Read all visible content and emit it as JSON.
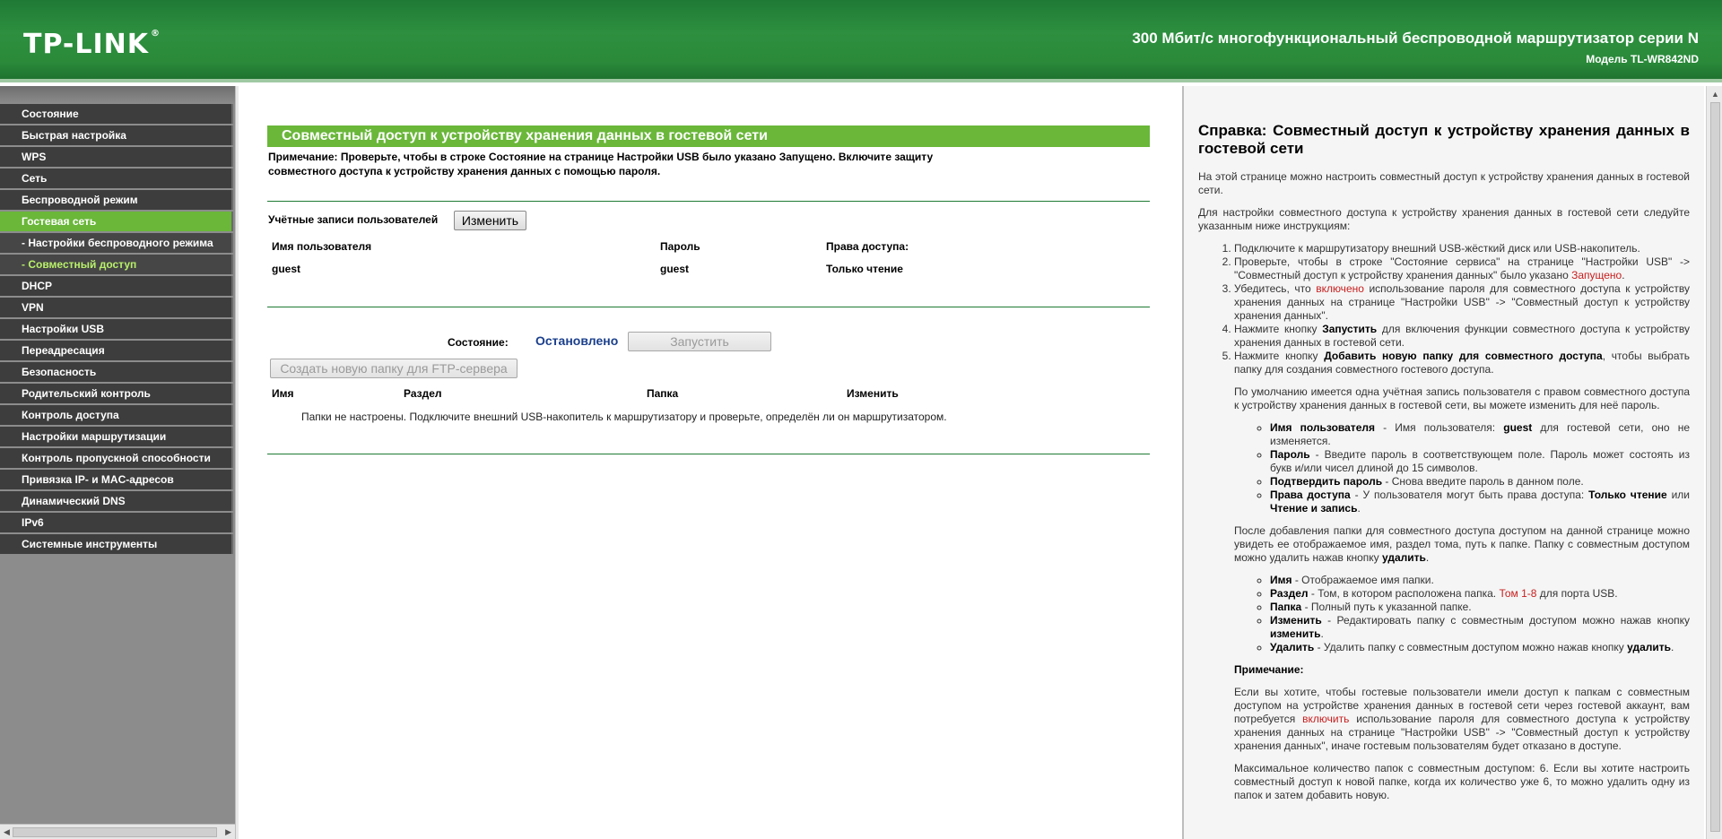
{
  "header": {
    "logo": "TP-LINK",
    "logo_mark": "®",
    "product_title": "300 Мбит/с многофункциональный беспроводной маршрутизатор серии N",
    "model": "Модель TL-WR842ND"
  },
  "sidebar": {
    "items": [
      {
        "label": "Состояние",
        "state": "normal"
      },
      {
        "label": "Быстрая настройка",
        "state": "normal"
      },
      {
        "label": "WPS",
        "state": "normal"
      },
      {
        "label": "Сеть",
        "state": "normal"
      },
      {
        "label": "Беспроводной режим",
        "state": "normal"
      },
      {
        "label": "Гостевая сеть",
        "state": "active"
      },
      {
        "label": "- Настройки беспроводного режима",
        "state": "sub"
      },
      {
        "label": "- Совместный доступ",
        "state": "sub-active"
      },
      {
        "label": "DHCP",
        "state": "normal"
      },
      {
        "label": "VPN",
        "state": "normal"
      },
      {
        "label": "Настройки USB",
        "state": "normal"
      },
      {
        "label": "Переадресация",
        "state": "normal"
      },
      {
        "label": "Безопасность",
        "state": "normal"
      },
      {
        "label": "Родительский контроль",
        "state": "normal"
      },
      {
        "label": "Контроль доступа",
        "state": "normal"
      },
      {
        "label": "Настройки маршрутизации",
        "state": "normal"
      },
      {
        "label": "Контроль пропускной способности",
        "state": "normal"
      },
      {
        "label": "Привязка IP- и MAC-адресов",
        "state": "normal"
      },
      {
        "label": "Динамический DNS",
        "state": "normal"
      },
      {
        "label": "IPv6",
        "state": "normal"
      },
      {
        "label": "Системные инструменты",
        "state": "normal"
      }
    ]
  },
  "main": {
    "title": "Совместный доступ к устройству хранения данных в гостевой сети",
    "note": "Примечание:    Проверьте, чтобы в строке Состояние на странице Настройки USB было указано Запущено. Включите защиту совместного доступа к устройству хранения данных с помощью пароля.",
    "accounts": {
      "label": "Учётные записи пользователей",
      "edit_button": "Изменить",
      "col_user": "Имя пользователя",
      "col_password": "Пароль",
      "col_rights": "Права доступа:",
      "user": "guest",
      "password": "guest",
      "rights": "Только чтение"
    },
    "status": {
      "label": "Состояние:",
      "value": "Остановлено",
      "start_button": "Запустить"
    },
    "new_folder_button": "Создать новую папку для FTP-сервера",
    "folders": {
      "col_name": "Имя",
      "col_volume": "Раздел",
      "col_folder": "Папка",
      "col_edit": "Изменить",
      "empty_message": "Папки не настроены. Подключите внешний USB-накопитель к маршрутизатору и проверьте, определён ли он маршрутизатором."
    }
  },
  "help": {
    "title": "Справка: Совместный доступ к устройству хранения данных в гостевой сети",
    "intro": "На этой странице можно настроить совместный доступ к устройству хранения данных в гостевой сети.",
    "instructions_intro": "Для настройки совместного доступа к устройству хранения данных в гостевой сети следуйте указанным ниже инструкциям:",
    "step1": "Подключите к маршрутизатору внешний USB-жёсткий диск или USB-накопитель.",
    "step2_a": "Проверьте, чтобы в строке \"Состояние сервиса\" на странице \"Настройки USB\" -> \"Совместный доступ к устройству хранения данных\" было указано ",
    "step2_red": "Запущено",
    "step2_b": ".",
    "step3_a": "Убедитесь, что ",
    "step3_red": "включено",
    "step3_b": " использование пароля для совместного доступа к устройству хранения данных на странице \"Настройки USB\" -> \"Совместный доступ к устройству хранения данных\".",
    "step4_a": "Нажмите кнопку ",
    "step4_bold": "Запустить",
    "step4_b": " для включения функции совместного доступа к устройству хранения данных в гостевой сети.",
    "step5_a": "Нажмите кнопку ",
    "step5_bold": "Добавить новую папку для совместного доступа",
    "step5_b": ", чтобы выбрать папку для создания совместного гостевого доступа.",
    "default_account": "По умолчанию имеется одна учётная запись пользователя с правом совместного доступа к устройству хранения данных в гостевой сети, вы можете изменить для неё пароль.",
    "acc_user_bold": "Имя пользователя",
    "acc_user_a": " - Имя пользователя: ",
    "acc_user_guest": "guest",
    "acc_user_b": " для гостевой сети, оно не изменяется.",
    "acc_pass_bold": "Пароль",
    "acc_pass_text": " - Введите пароль в соответствующем поле. Пароль может состоять из букв и/или чисел длиной до 15 символов.",
    "acc_confirm_bold": "Подтвердить пароль",
    "acc_confirm_text": " - Снова введите пароль в данном поле.",
    "acc_rights_bold": "Права доступа",
    "acc_rights_a": " - У пользователя могут быть права доступа: ",
    "acc_rights_ro": "Только чтение",
    "acc_rights_or": " или ",
    "acc_rights_rw": "Чтение и запись",
    "acc_rights_end": ".",
    "after_add_a": "После добавления папки для совместного доступа доступом на данной странице можно увидеть ее отображаемое имя, раздел тома, путь к папке. Папку с совместным доступом можно удалить нажав кнопку ",
    "after_add_bold": "удалить",
    "after_add_b": ".",
    "f_name_bold": "Имя",
    "f_name_text": " - Отображаемое имя папки.",
    "f_vol_bold": "Раздел",
    "f_vol_a": " - Том, в котором расположена папка. ",
    "f_vol_red": "Том 1-8",
    "f_vol_b": " для порта USB.",
    "f_folder_bold": "Папка",
    "f_folder_text": " - Полный путь к указанной папке.",
    "f_edit_bold": "Изменить",
    "f_edit_a": " - Редактировать папку с совместным доступом можно нажав кнопку ",
    "f_edit_bold2": "изменить",
    "f_edit_b": ".",
    "f_del_bold": "Удалить",
    "f_del_a": " - Удалить папку с совместным доступом можно нажав кнопку ",
    "f_del_bold2": "удалить",
    "f_del_b": ".",
    "note_title": "Примечание:",
    "note_a": "Если вы хотите, чтобы гостевые пользователи имели доступ к папкам с совместным доступом на устройстве хранения данных в гостевой сети через гостевой аккаунт, вам потребуется ",
    "note_red": "включить",
    "note_b": " использование пароля для совместного доступа к устройству хранения данных на странице \"Настройки USB\" -> \"Совместный доступ к устройству хранения данных\", иначе гостевым пользователям будет отказано в доступе.",
    "max_folders": "Максимальное количество папок с совместным доступом: 6. Если вы хотите настроить совместный доступ к новой папке, когда их количество уже 6, то можно удалить одну из папок и затем добавить новую."
  },
  "colors": {
    "header_green": "#2d8f3f",
    "accent_green": "#6ab73a",
    "sidebar_dark": "#3d3d3d",
    "status_blue": "#1a3f8c",
    "help_red": "#c81e1e"
  }
}
